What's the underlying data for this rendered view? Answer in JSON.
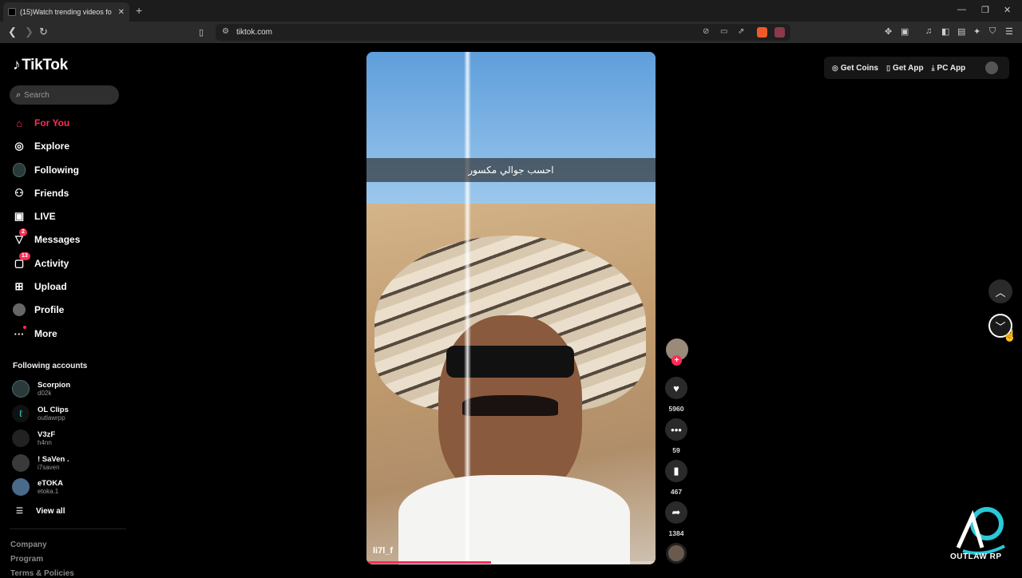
{
  "browser": {
    "tab_title": "(15)Watch trending videos fo",
    "tab_close": "✕",
    "new_tab": "+",
    "url": "tiktok.com"
  },
  "sidebar": {
    "logo": "TikTok",
    "search_placeholder": "Search",
    "nav": [
      {
        "label": "For You",
        "icon": "home-icon"
      },
      {
        "label": "Explore",
        "icon": "compass-icon"
      },
      {
        "label": "Following",
        "icon": "avatar-icon"
      },
      {
        "label": "Friends",
        "icon": "friends-icon"
      },
      {
        "label": "LIVE",
        "icon": "live-icon"
      },
      {
        "label": "Messages",
        "icon": "messages-icon",
        "badge": "2"
      },
      {
        "label": "Activity",
        "icon": "activity-icon",
        "badge": "13"
      },
      {
        "label": "Upload",
        "icon": "upload-icon"
      },
      {
        "label": "Profile",
        "icon": "profile-icon"
      },
      {
        "label": "More",
        "icon": "more-icon"
      }
    ],
    "following_title": "Following accounts",
    "accounts": [
      {
        "name": "Scorpion",
        "handle": "d02k"
      },
      {
        "name": "OL Clips",
        "handle": "outlawrpp"
      },
      {
        "name": "V3zF",
        "handle": "h4nn"
      },
      {
        "name": "! SaVen .",
        "handle": "i7saven"
      },
      {
        "name": "eTOKA",
        "handle": "etoka.1"
      }
    ],
    "view_all": "View all",
    "footer": [
      "Company",
      "Program",
      "Terms & Policies"
    ]
  },
  "video": {
    "caption": "احسب جوالي مكسور",
    "author": "li7l_f",
    "progress": 0.43
  },
  "actions": {
    "likes": "5960",
    "comments": "59",
    "saves": "467",
    "shares": "1384"
  },
  "topbar": {
    "get_coins": "Get Coins",
    "get_app": "Get App",
    "pc_app": "PC App"
  },
  "watermark": "OUTLAW RP",
  "colors": {
    "accent": "#fe2c55",
    "background": "#000000"
  }
}
